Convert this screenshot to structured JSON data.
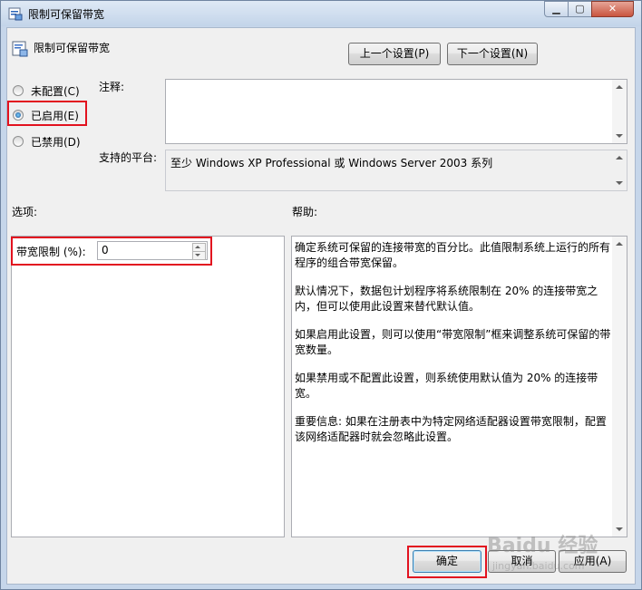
{
  "window": {
    "title": "限制可保留带宽",
    "minimize_icon": "minimize-icon",
    "maximize_icon": "maximize-icon",
    "close_icon": "close-icon"
  },
  "header": {
    "policy_name": "限制可保留带宽",
    "prev_button": "上一个设置(P)",
    "next_button": "下一个设置(N)"
  },
  "state": {
    "options": [
      {
        "label": "未配置(C)",
        "checked": false
      },
      {
        "label": "已启用(E)",
        "checked": true
      },
      {
        "label": "已禁用(D)",
        "checked": false
      }
    ]
  },
  "comment": {
    "label": "注释:",
    "value": ""
  },
  "platform": {
    "label": "支持的平台:",
    "value": "至少 Windows XP Professional 或 Windows Server 2003 系列"
  },
  "options_panel": {
    "heading": "选项:",
    "bandwidth_label": "带宽限制 (%):",
    "bandwidth_value": "0"
  },
  "help_panel": {
    "heading": "帮助:",
    "paragraphs": [
      "确定系统可保留的连接带宽的百分比。此值限制系统上运行的所有程序的组合带宽保留。",
      "默认情况下，数据包计划程序将系统限制在 20% 的连接带宽之内，但可以使用此设置来替代默认值。",
      "如果启用此设置，则可以使用“带宽限制”框来调整系统可保留的带宽数量。",
      "如果禁用或不配置此设置，则系统使用默认值为 20% 的连接带宽。",
      "重要信息: 如果在注册表中为特定网络适配器设置带宽限制，配置该网络适配器时就会忽略此设置。"
    ]
  },
  "footer": {
    "ok_button": "确定",
    "cancel_button": "取消",
    "apply_button": "应用(A)"
  },
  "watermark": {
    "brand": "Baidu 经验",
    "url": "jingyan.baidu.com"
  },
  "colors": {
    "highlight": "#e2121f",
    "window_frame": "#c6d6ea",
    "dialog_bg": "#f0f0f0"
  }
}
